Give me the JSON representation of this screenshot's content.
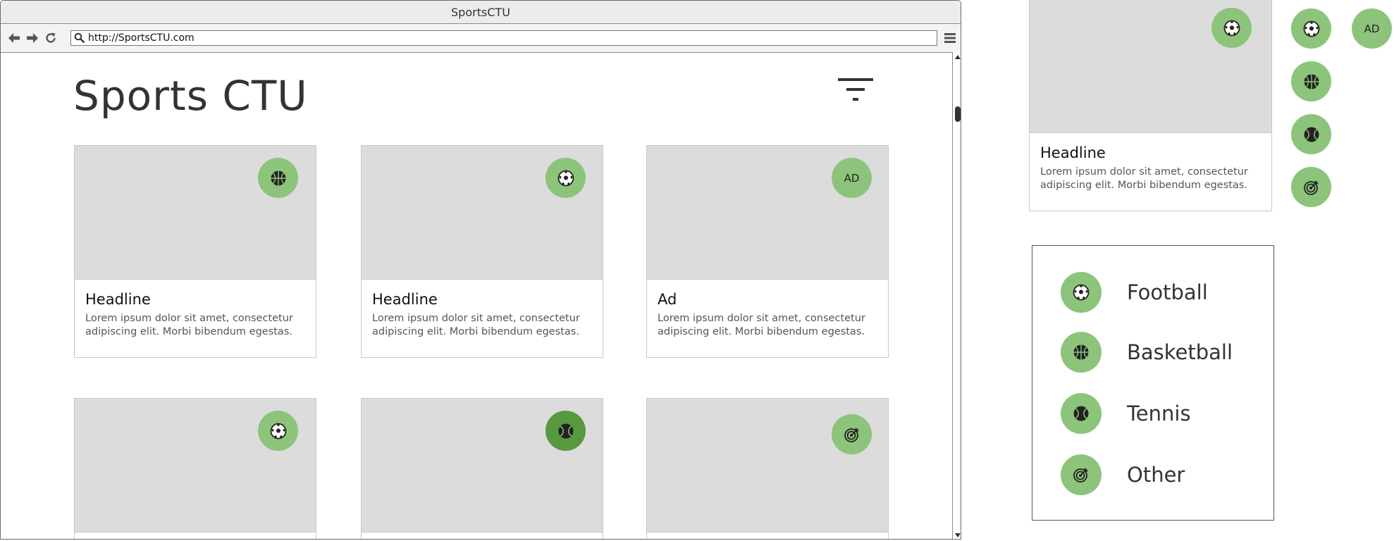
{
  "browser": {
    "window_title": "SportsCTU",
    "url": "http://SportsCTU.com"
  },
  "page": {
    "site_title": "Sports CTU"
  },
  "cards": [
    {
      "headline": "Headline",
      "text": "Lorem ipsum dolor sit amet, consectetur adipiscing elit. Morbi bibendum egestas.",
      "badge": "basketball-icon"
    },
    {
      "headline": "Headline",
      "text": "Lorem ipsum dolor sit amet, consectetur adipiscing elit. Morbi bibendum egestas.",
      "badge": "soccer-ball-icon"
    },
    {
      "headline": "Ad",
      "text": "Lorem ipsum dolor sit amet, consectetur adipiscing elit. Morbi bibendum egestas.",
      "badge_text": "AD"
    },
    {
      "badge": "soccer-ball-icon"
    },
    {
      "badge": "tennis-ball-icon"
    },
    {
      "badge": "target-icon"
    }
  ],
  "component_card": {
    "headline": "Headline",
    "text": "Lorem ipsum dolor sit amet, consectetur adipiscing elit. Morbi bibendum egestas.",
    "badge": "soccer-ball-icon"
  },
  "loose_badges": {
    "ad_text": "AD"
  },
  "legend": {
    "items": [
      {
        "label": "Football",
        "icon": "soccer-ball-icon"
      },
      {
        "label": "Basketball",
        "icon": "basketball-icon"
      },
      {
        "label": "Tennis",
        "icon": "tennis-ball-icon"
      },
      {
        "label": "Other",
        "icon": "target-icon"
      }
    ]
  },
  "colors": {
    "badge_green": "#8dc47b",
    "badge_green_active": "#56993f",
    "placeholder_gray": "#dcdcdc"
  }
}
